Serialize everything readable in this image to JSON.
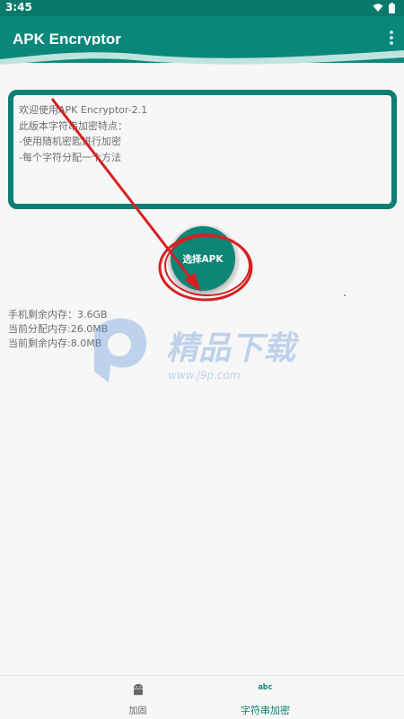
{
  "status_bar": {
    "time": "3:45"
  },
  "app_bar": {
    "title": "APK Encryptor"
  },
  "info": {
    "text": "欢迎使用APK Encryptor-2.1\n此版本字符串加密特点：\n-使用随机密匙进行加密\n-每个字符分配一个方法"
  },
  "select_button": {
    "label": "选择APK"
  },
  "memory": {
    "phone_free": "手机剩余内存：3.6GB",
    "allocated": "当前分配内存:26.0MB",
    "remaining": "当前剩余内存:8.0MB"
  },
  "watermark": {
    "brand": "精品下载",
    "url": "www.j9p.com"
  },
  "bottom_nav": {
    "items": [
      {
        "label": "加固",
        "icon": "android-icon",
        "active": false
      },
      {
        "label": "字符串加密",
        "icon": "abc-icon",
        "icon_text": "abc",
        "active": true
      }
    ]
  },
  "colors": {
    "primary": "#09877a",
    "accent": "#0a7f72",
    "annotation": "#d62020"
  }
}
